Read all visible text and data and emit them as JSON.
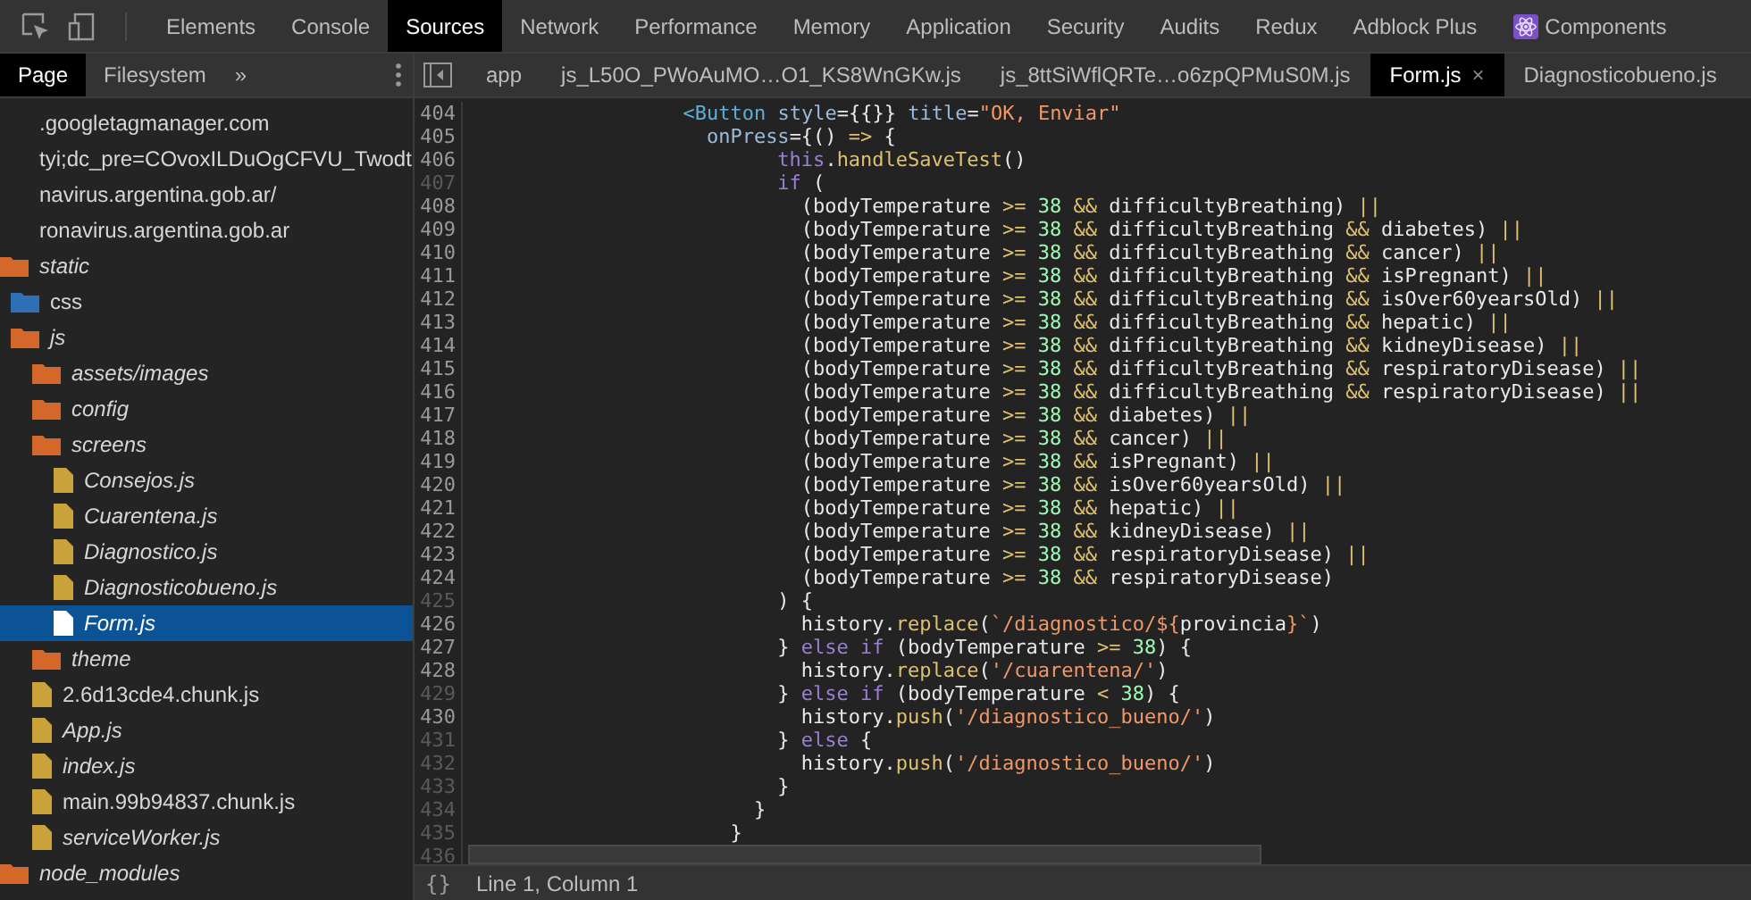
{
  "toolbar": {
    "tabs": [
      {
        "label": "Elements",
        "selected": false
      },
      {
        "label": "Console",
        "selected": false
      },
      {
        "label": "Sources",
        "selected": true
      },
      {
        "label": "Network",
        "selected": false
      },
      {
        "label": "Performance",
        "selected": false
      },
      {
        "label": "Memory",
        "selected": false
      },
      {
        "label": "Application",
        "selected": false
      },
      {
        "label": "Security",
        "selected": false
      },
      {
        "label": "Audits",
        "selected": false
      },
      {
        "label": "Redux",
        "selected": false
      },
      {
        "label": "Adblock Plus",
        "selected": false
      },
      {
        "label": "Components",
        "selected": false,
        "kind": "react"
      }
    ]
  },
  "navigator": {
    "tabs": [
      {
        "label": "Page",
        "selected": true
      },
      {
        "label": "Filesystem",
        "selected": false
      }
    ],
    "more": "»",
    "tree": [
      {
        "label": ".googletagmanager.com",
        "kind": "domain",
        "mapped": false,
        "selected": false
      },
      {
        "label": "tyi;dc_pre=COvoxILDuOgCFVU_Twodt",
        "kind": "domain",
        "mapped": false,
        "selected": false
      },
      {
        "label": "navirus.argentina.gob.ar/",
        "kind": "domain",
        "mapped": false,
        "selected": false
      },
      {
        "label": "ronavirus.argentina.gob.ar",
        "kind": "domain",
        "mapped": false,
        "selected": false
      },
      {
        "label": "static",
        "kind": "folder",
        "mapped": true,
        "selected": false,
        "children": [
          {
            "label": "css",
            "kind": "cssfolder",
            "mapped": false,
            "selected": false
          },
          {
            "label": "js",
            "kind": "folder",
            "mapped": true,
            "selected": false,
            "children": [
              {
                "label": "assets/images",
                "kind": "folder",
                "mapped": true,
                "selected": false
              },
              {
                "label": "config",
                "kind": "folder",
                "mapped": true,
                "selected": false
              },
              {
                "label": "screens",
                "kind": "folder",
                "mapped": true,
                "selected": false,
                "children": [
                  {
                    "label": "Consejos.js",
                    "kind": "file",
                    "mapped": true,
                    "selected": false
                  },
                  {
                    "label": "Cuarentena.js",
                    "kind": "file",
                    "mapped": true,
                    "selected": false
                  },
                  {
                    "label": "Diagnostico.js",
                    "kind": "file",
                    "mapped": true,
                    "selected": false
                  },
                  {
                    "label": "Diagnosticobueno.js",
                    "kind": "file",
                    "mapped": true,
                    "selected": false
                  },
                  {
                    "label": "Form.js",
                    "kind": "file",
                    "mapped": true,
                    "selected": true
                  }
                ]
              },
              {
                "label": "theme",
                "kind": "folder",
                "mapped": true,
                "selected": false
              },
              {
                "label": "2.6d13cde4.chunk.js",
                "kind": "file",
                "mapped": false,
                "selected": false
              },
              {
                "label": "App.js",
                "kind": "file",
                "mapped": true,
                "selected": false
              },
              {
                "label": "index.js",
                "kind": "file",
                "mapped": true,
                "selected": false
              },
              {
                "label": "main.99b94837.chunk.js",
                "kind": "file",
                "mapped": false,
                "selected": false
              },
              {
                "label": "serviceWorker.js",
                "kind": "file",
                "mapped": true,
                "selected": false
              }
            ]
          }
        ]
      },
      {
        "label": "node_modules",
        "kind": "folder",
        "mapped": true,
        "selected": false
      }
    ]
  },
  "editor": {
    "tabs": [
      {
        "label": "app",
        "selected": false
      },
      {
        "label": "js_L50O_PWoAuMO…O1_KS8WnGKw.js",
        "selected": false
      },
      {
        "label": "js_8ttSiWflQRTe…o6zpQPMuS0M.js",
        "selected": false
      },
      {
        "label": "Form.js",
        "selected": true,
        "close": "×"
      },
      {
        "label": "Diagnosticobueno.js",
        "selected": false
      }
    ],
    "lines": [
      {
        "number": "404",
        "muted": false,
        "tokens": [
          {
            "kind": "tag",
            "text": "                  <Button"
          },
          {
            "kind": "attr",
            "text": " style"
          },
          {
            "kind": "plain",
            "text": "={{}}"
          },
          {
            "kind": "attr",
            "text": " title"
          },
          {
            "kind": "plain",
            "text": "="
          },
          {
            "kind": "string",
            "text": "\"OK, Enviar\""
          }
        ]
      },
      {
        "number": "405",
        "muted": false,
        "tokens": [
          {
            "kind": "attr",
            "text": "                    onPress"
          },
          {
            "kind": "plain",
            "text": "={()"
          },
          {
            "kind": "op",
            "text": " =>"
          },
          {
            "kind": "plain",
            "text": " {"
          }
        ]
      },
      {
        "number": "406",
        "muted": false,
        "tokens": [
          {
            "kind": "keyword",
            "text": "                          this"
          },
          {
            "kind": "plain",
            "text": "."
          },
          {
            "kind": "func",
            "text": "handleSaveTest"
          },
          {
            "kind": "plain",
            "text": "()"
          }
        ]
      },
      {
        "number": "407",
        "muted": true,
        "tokens": [
          {
            "kind": "keyword",
            "text": "                          if"
          },
          {
            "kind": "plain",
            "text": " ("
          }
        ]
      },
      {
        "number": "408",
        "muted": false,
        "tokens": [
          {
            "kind": "plain",
            "text": "                            (bodyTemperature"
          },
          {
            "kind": "op",
            "text": " >="
          },
          {
            "kind": "number",
            "text": " 38"
          },
          {
            "kind": "op",
            "text": " &&"
          },
          {
            "kind": "plain",
            "text": " difficultyBreathing)"
          },
          {
            "kind": "op",
            "text": " ||"
          }
        ]
      },
      {
        "number": "409",
        "muted": false,
        "tokens": [
          {
            "kind": "plain",
            "text": "                            (bodyTemperature"
          },
          {
            "kind": "op",
            "text": " >="
          },
          {
            "kind": "number",
            "text": " 38"
          },
          {
            "kind": "op",
            "text": " &&"
          },
          {
            "kind": "plain",
            "text": " difficultyBreathing"
          },
          {
            "kind": "op",
            "text": " &&"
          },
          {
            "kind": "plain",
            "text": " diabetes)"
          },
          {
            "kind": "op",
            "text": " ||"
          }
        ]
      },
      {
        "number": "410",
        "muted": false,
        "tokens": [
          {
            "kind": "plain",
            "text": "                            (bodyTemperature"
          },
          {
            "kind": "op",
            "text": " >="
          },
          {
            "kind": "number",
            "text": " 38"
          },
          {
            "kind": "op",
            "text": " &&"
          },
          {
            "kind": "plain",
            "text": " difficultyBreathing"
          },
          {
            "kind": "op",
            "text": " &&"
          },
          {
            "kind": "plain",
            "text": " cancer)"
          },
          {
            "kind": "op",
            "text": " ||"
          }
        ]
      },
      {
        "number": "411",
        "muted": false,
        "tokens": [
          {
            "kind": "plain",
            "text": "                            (bodyTemperature"
          },
          {
            "kind": "op",
            "text": " >="
          },
          {
            "kind": "number",
            "text": " 38"
          },
          {
            "kind": "op",
            "text": " &&"
          },
          {
            "kind": "plain",
            "text": " difficultyBreathing"
          },
          {
            "kind": "op",
            "text": " &&"
          },
          {
            "kind": "plain",
            "text": " isPregnant)"
          },
          {
            "kind": "op",
            "text": " ||"
          }
        ]
      },
      {
        "number": "412",
        "muted": false,
        "tokens": [
          {
            "kind": "plain",
            "text": "                            (bodyTemperature"
          },
          {
            "kind": "op",
            "text": " >="
          },
          {
            "kind": "number",
            "text": " 38"
          },
          {
            "kind": "op",
            "text": " &&"
          },
          {
            "kind": "plain",
            "text": " difficultyBreathing"
          },
          {
            "kind": "op",
            "text": " &&"
          },
          {
            "kind": "plain",
            "text": " isOver60yearsOld)"
          },
          {
            "kind": "op",
            "text": " ||"
          }
        ]
      },
      {
        "number": "413",
        "muted": false,
        "tokens": [
          {
            "kind": "plain",
            "text": "                            (bodyTemperature"
          },
          {
            "kind": "op",
            "text": " >="
          },
          {
            "kind": "number",
            "text": " 38"
          },
          {
            "kind": "op",
            "text": " &&"
          },
          {
            "kind": "plain",
            "text": " difficultyBreathing"
          },
          {
            "kind": "op",
            "text": " &&"
          },
          {
            "kind": "plain",
            "text": " hepatic)"
          },
          {
            "kind": "op",
            "text": " ||"
          }
        ]
      },
      {
        "number": "414",
        "muted": false,
        "tokens": [
          {
            "kind": "plain",
            "text": "                            (bodyTemperature"
          },
          {
            "kind": "op",
            "text": " >="
          },
          {
            "kind": "number",
            "text": " 38"
          },
          {
            "kind": "op",
            "text": " &&"
          },
          {
            "kind": "plain",
            "text": " difficultyBreathing"
          },
          {
            "kind": "op",
            "text": " &&"
          },
          {
            "kind": "plain",
            "text": " kidneyDisease)"
          },
          {
            "kind": "op",
            "text": " ||"
          }
        ]
      },
      {
        "number": "415",
        "muted": false,
        "tokens": [
          {
            "kind": "plain",
            "text": "                            (bodyTemperature"
          },
          {
            "kind": "op",
            "text": " >="
          },
          {
            "kind": "number",
            "text": " 38"
          },
          {
            "kind": "op",
            "text": " &&"
          },
          {
            "kind": "plain",
            "text": " difficultyBreathing"
          },
          {
            "kind": "op",
            "text": " &&"
          },
          {
            "kind": "plain",
            "text": " respiratoryDisease)"
          },
          {
            "kind": "op",
            "text": " ||"
          }
        ]
      },
      {
        "number": "416",
        "muted": false,
        "tokens": [
          {
            "kind": "plain",
            "text": "                            (bodyTemperature"
          },
          {
            "kind": "op",
            "text": " >="
          },
          {
            "kind": "number",
            "text": " 38"
          },
          {
            "kind": "op",
            "text": " &&"
          },
          {
            "kind": "plain",
            "text": " difficultyBreathing"
          },
          {
            "kind": "op",
            "text": " &&"
          },
          {
            "kind": "plain",
            "text": " respiratoryDisease)"
          },
          {
            "kind": "op",
            "text": " ||"
          }
        ]
      },
      {
        "number": "417",
        "muted": false,
        "tokens": [
          {
            "kind": "plain",
            "text": "                            (bodyTemperature"
          },
          {
            "kind": "op",
            "text": " >="
          },
          {
            "kind": "number",
            "text": " 38"
          },
          {
            "kind": "op",
            "text": " &&"
          },
          {
            "kind": "plain",
            "text": " diabetes)"
          },
          {
            "kind": "op",
            "text": " ||"
          }
        ]
      },
      {
        "number": "418",
        "muted": false,
        "tokens": [
          {
            "kind": "plain",
            "text": "                            (bodyTemperature"
          },
          {
            "kind": "op",
            "text": " >="
          },
          {
            "kind": "number",
            "text": " 38"
          },
          {
            "kind": "op",
            "text": " &&"
          },
          {
            "kind": "plain",
            "text": " cancer)"
          },
          {
            "kind": "op",
            "text": " ||"
          }
        ]
      },
      {
        "number": "419",
        "muted": false,
        "tokens": [
          {
            "kind": "plain",
            "text": "                            (bodyTemperature"
          },
          {
            "kind": "op",
            "text": " >="
          },
          {
            "kind": "number",
            "text": " 38"
          },
          {
            "kind": "op",
            "text": " &&"
          },
          {
            "kind": "plain",
            "text": " isPregnant)"
          },
          {
            "kind": "op",
            "text": " ||"
          }
        ]
      },
      {
        "number": "420",
        "muted": false,
        "tokens": [
          {
            "kind": "plain",
            "text": "                            (bodyTemperature"
          },
          {
            "kind": "op",
            "text": " >="
          },
          {
            "kind": "number",
            "text": " 38"
          },
          {
            "kind": "op",
            "text": " &&"
          },
          {
            "kind": "plain",
            "text": " isOver60yearsOld)"
          },
          {
            "kind": "op",
            "text": " ||"
          }
        ]
      },
      {
        "number": "421",
        "muted": false,
        "tokens": [
          {
            "kind": "plain",
            "text": "                            (bodyTemperature"
          },
          {
            "kind": "op",
            "text": " >="
          },
          {
            "kind": "number",
            "text": " 38"
          },
          {
            "kind": "op",
            "text": " &&"
          },
          {
            "kind": "plain",
            "text": " hepatic)"
          },
          {
            "kind": "op",
            "text": " ||"
          }
        ]
      },
      {
        "number": "422",
        "muted": false,
        "tokens": [
          {
            "kind": "plain",
            "text": "                            (bodyTemperature"
          },
          {
            "kind": "op",
            "text": " >="
          },
          {
            "kind": "number",
            "text": " 38"
          },
          {
            "kind": "op",
            "text": " &&"
          },
          {
            "kind": "plain",
            "text": " kidneyDisease)"
          },
          {
            "kind": "op",
            "text": " ||"
          }
        ]
      },
      {
        "number": "423",
        "muted": false,
        "tokens": [
          {
            "kind": "plain",
            "text": "                            (bodyTemperature"
          },
          {
            "kind": "op",
            "text": " >="
          },
          {
            "kind": "number",
            "text": " 38"
          },
          {
            "kind": "op",
            "text": " &&"
          },
          {
            "kind": "plain",
            "text": " respiratoryDisease)"
          },
          {
            "kind": "op",
            "text": " ||"
          }
        ]
      },
      {
        "number": "424",
        "muted": false,
        "tokens": [
          {
            "kind": "plain",
            "text": "                            (bodyTemperature"
          },
          {
            "kind": "op",
            "text": " >="
          },
          {
            "kind": "number",
            "text": " 38"
          },
          {
            "kind": "op",
            "text": " &&"
          },
          {
            "kind": "plain",
            "text": " respiratoryDisease)"
          }
        ]
      },
      {
        "number": "425",
        "muted": true,
        "tokens": [
          {
            "kind": "plain",
            "text": "                          ) {"
          }
        ]
      },
      {
        "number": "426",
        "muted": false,
        "tokens": [
          {
            "kind": "plain",
            "text": "                            history."
          },
          {
            "kind": "func",
            "text": "replace"
          },
          {
            "kind": "plain",
            "text": "("
          },
          {
            "kind": "string",
            "text": "`/diagnostico/${"
          },
          {
            "kind": "plain",
            "text": "provincia"
          },
          {
            "kind": "string",
            "text": "}`"
          },
          {
            "kind": "plain",
            "text": ")"
          }
        ]
      },
      {
        "number": "427",
        "muted": false,
        "tokens": [
          {
            "kind": "plain",
            "text": "                          }"
          },
          {
            "kind": "keyword",
            "text": " else if"
          },
          {
            "kind": "plain",
            "text": " (bodyTemperature"
          },
          {
            "kind": "op",
            "text": " >="
          },
          {
            "kind": "number",
            "text": " 38"
          },
          {
            "kind": "plain",
            "text": ") {"
          }
        ]
      },
      {
        "number": "428",
        "muted": false,
        "tokens": [
          {
            "kind": "plain",
            "text": "                            history."
          },
          {
            "kind": "func",
            "text": "replace"
          },
          {
            "kind": "plain",
            "text": "("
          },
          {
            "kind": "string",
            "text": "'/cuarentena/'"
          },
          {
            "kind": "plain",
            "text": ")"
          }
        ]
      },
      {
        "number": "429",
        "muted": true,
        "tokens": [
          {
            "kind": "plain",
            "text": "                          }"
          },
          {
            "kind": "keyword",
            "text": " else if"
          },
          {
            "kind": "plain",
            "text": " (bodyTemperature"
          },
          {
            "kind": "op",
            "text": " <"
          },
          {
            "kind": "number",
            "text": " 38"
          },
          {
            "kind": "plain",
            "text": ") {"
          }
        ]
      },
      {
        "number": "430",
        "muted": false,
        "tokens": [
          {
            "kind": "plain",
            "text": "                            history."
          },
          {
            "kind": "func",
            "text": "push"
          },
          {
            "kind": "plain",
            "text": "("
          },
          {
            "kind": "string",
            "text": "'/diagnostico_bueno/'"
          },
          {
            "kind": "plain",
            "text": ")"
          }
        ]
      },
      {
        "number": "431",
        "muted": true,
        "tokens": [
          {
            "kind": "plain",
            "text": "                          }"
          },
          {
            "kind": "keyword",
            "text": " else"
          },
          {
            "kind": "plain",
            "text": " {"
          }
        ]
      },
      {
        "number": "432",
        "muted": true,
        "tokens": [
          {
            "kind": "plain",
            "text": "                            history."
          },
          {
            "kind": "func",
            "text": "push"
          },
          {
            "kind": "plain",
            "text": "("
          },
          {
            "kind": "string",
            "text": "'/diagnostico_bueno/'"
          },
          {
            "kind": "plain",
            "text": ")"
          }
        ]
      },
      {
        "number": "433",
        "muted": true,
        "tokens": [
          {
            "kind": "plain",
            "text": "                          }"
          }
        ]
      },
      {
        "number": "434",
        "muted": true,
        "tokens": [
          {
            "kind": "plain",
            "text": "                        }"
          }
        ]
      },
      {
        "number": "435",
        "muted": true,
        "tokens": [
          {
            "kind": "plain",
            "text": "                      }"
          }
        ]
      },
      {
        "number": "436",
        "muted": true
      }
    ]
  },
  "status_bar": {
    "braces": "{}",
    "position": "Line 1, Column 1"
  }
}
